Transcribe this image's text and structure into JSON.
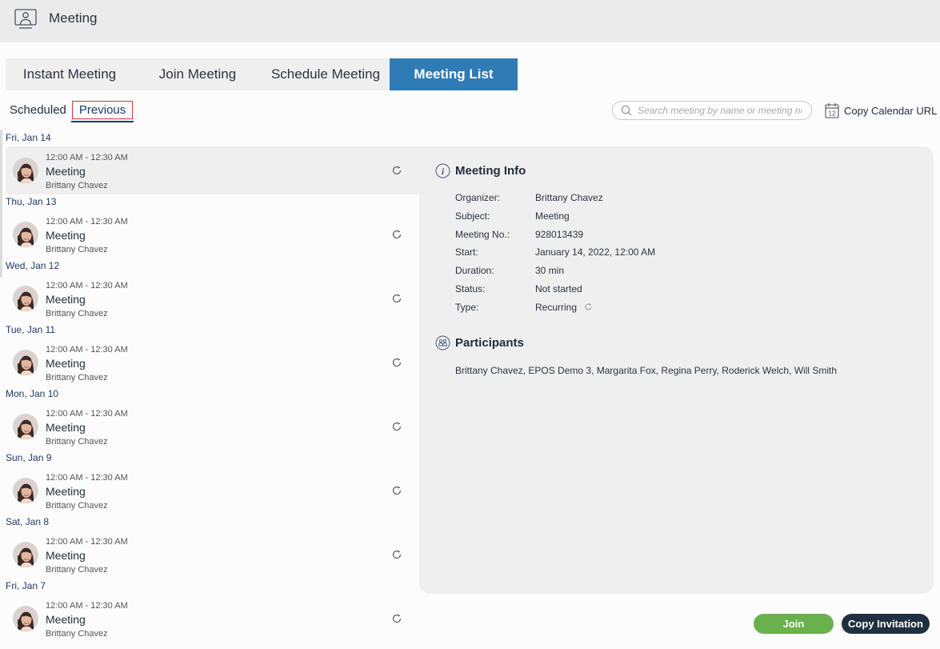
{
  "app": {
    "title": "Meeting",
    "icon": "meeting-screen-icon"
  },
  "tabs": [
    {
      "label": "Instant Meeting",
      "active": false
    },
    {
      "label": "Join Meeting",
      "active": false
    },
    {
      "label": "Schedule Meeting",
      "active": false
    },
    {
      "label": "Meeting List",
      "active": true
    }
  ],
  "subtabs": {
    "scheduled": "Scheduled",
    "previous": "Previous",
    "active": "previous"
  },
  "search": {
    "placeholder": "Search meeting by name or meeting number",
    "value": ""
  },
  "copy_calendar": {
    "label": "Copy Calendar URL",
    "icon": "calendar-icon",
    "icon_text": "12"
  },
  "meetings": [
    {
      "day": "Fri, Jan 14",
      "time": "12:00 AM - 12:30 AM",
      "title": "Meeting",
      "organizer": "Brittany Chavez",
      "recurring": true,
      "selected": true
    },
    {
      "day": "Thu, Jan 13",
      "time": "12:00 AM - 12:30 AM",
      "title": "Meeting",
      "organizer": "Brittany Chavez",
      "recurring": true,
      "selected": false
    },
    {
      "day": "Wed, Jan 12",
      "time": "12:00 AM - 12:30 AM",
      "title": "Meeting",
      "organizer": "Brittany Chavez",
      "recurring": true,
      "selected": false
    },
    {
      "day": "Tue, Jan 11",
      "time": "12:00 AM - 12:30 AM",
      "title": "Meeting",
      "organizer": "Brittany Chavez",
      "recurring": true,
      "selected": false
    },
    {
      "day": "Mon, Jan 10",
      "time": "12:00 AM - 12:30 AM",
      "title": "Meeting",
      "organizer": "Brittany Chavez",
      "recurring": true,
      "selected": false
    },
    {
      "day": "Sun, Jan 9",
      "time": "12:00 AM - 12:30 AM",
      "title": "Meeting",
      "organizer": "Brittany Chavez",
      "recurring": true,
      "selected": false
    },
    {
      "day": "Sat, Jan 8",
      "time": "12:00 AM - 12:30 AM",
      "title": "Meeting",
      "organizer": "Brittany Chavez",
      "recurring": true,
      "selected": false
    },
    {
      "day": "Fri, Jan 7",
      "time": "12:00 AM - 12:30 AM",
      "title": "Meeting",
      "organizer": "Brittany Chavez",
      "recurring": true,
      "selected": false
    }
  ],
  "details": {
    "info_title": "Meeting Info",
    "rows": [
      {
        "key": "Organizer:",
        "value": "Brittany Chavez"
      },
      {
        "key": "Subject:",
        "value": "Meeting"
      },
      {
        "key": "Meeting No.:",
        "value": "928013439"
      },
      {
        "key": "Start:",
        "value": "January 14, 2022, 12:00 AM"
      },
      {
        "key": "Duration:",
        "value": "30 min"
      },
      {
        "key": "Status:",
        "value": "Not started"
      },
      {
        "key": "Type:",
        "value": "Recurring"
      }
    ],
    "participants_title": "Participants",
    "participants": "Brittany Chavez, EPOS Demo 3, Margarita Fox, Regina Perry, Roderick Welch, Will Smith"
  },
  "actions": {
    "join": "Join",
    "copy_invitation": "Copy Invitation"
  },
  "colors": {
    "active_tab": "#2f7bb5",
    "join": "#6ab04c",
    "copy_invitation": "#1f3140",
    "day_label": "#1e3a6b",
    "previous_outline": "#d13a3a"
  }
}
